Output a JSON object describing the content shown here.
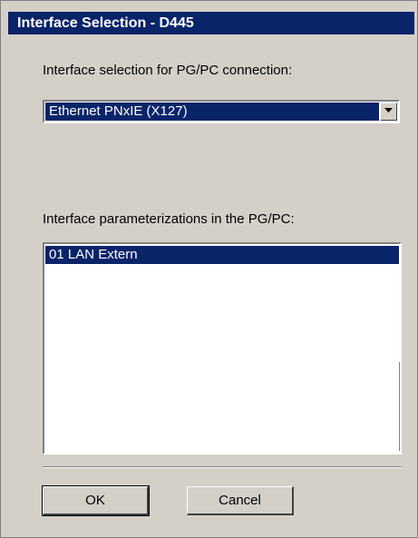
{
  "window": {
    "title": "Interface Selection - D445"
  },
  "connection": {
    "label": "Interface selection for PG/PC connection:",
    "selected_value": "Ethernet PNxIE (X127)"
  },
  "parameterizations": {
    "label": "Interface parameterizations in the PG/PC:",
    "items": [
      "01 LAN Extern"
    ]
  },
  "buttons": {
    "ok_label": "OK",
    "cancel_label": "Cancel"
  },
  "colors": {
    "dialog_bg": "#d4d0c8",
    "selection": "#0a246a"
  }
}
